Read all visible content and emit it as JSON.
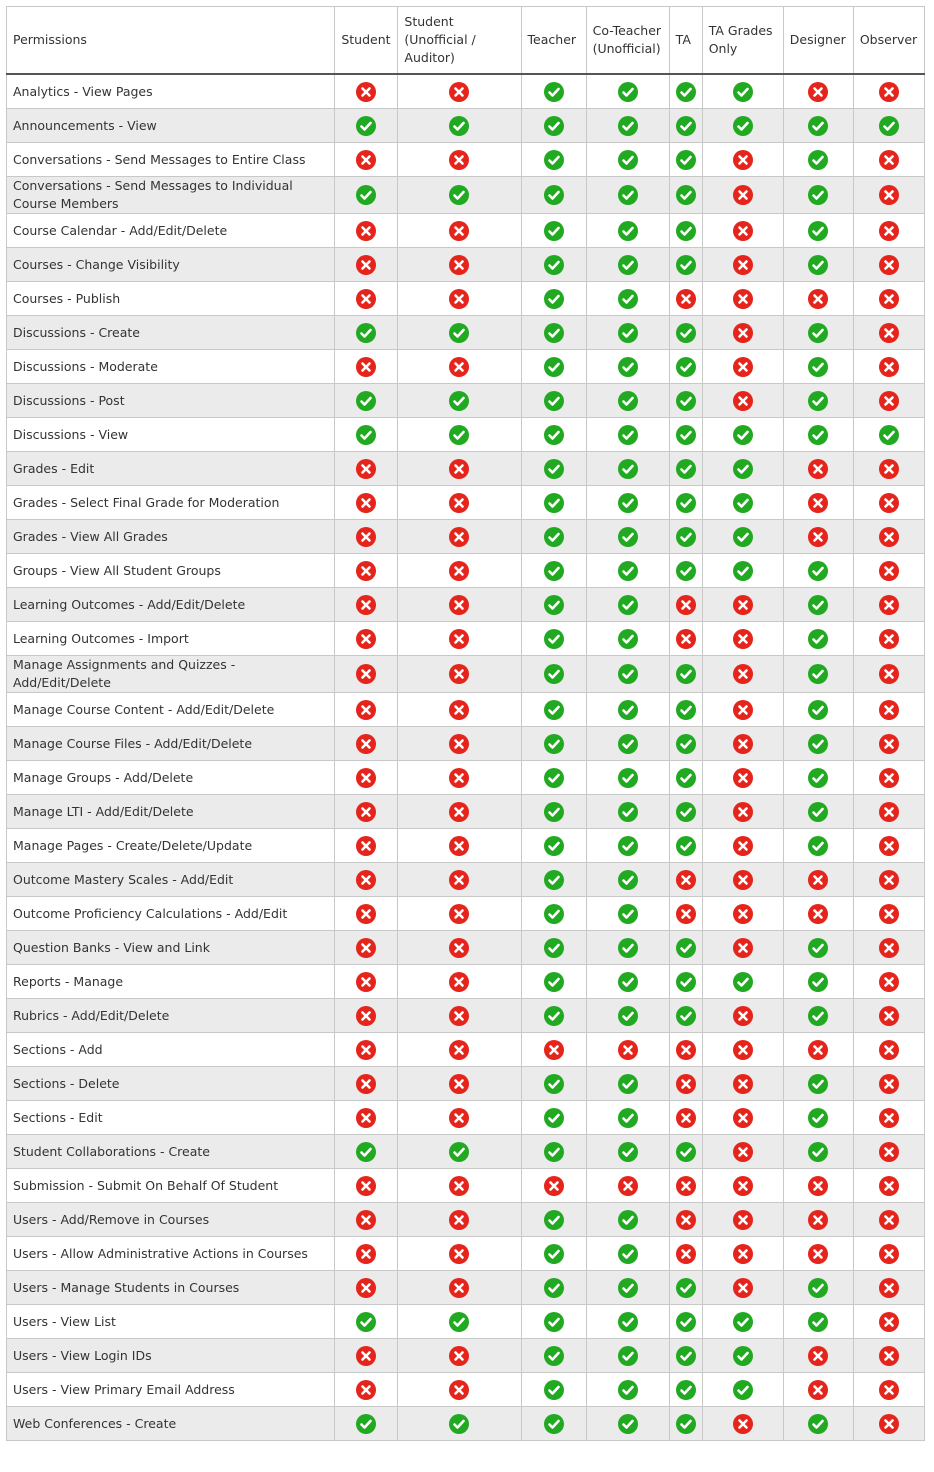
{
  "colors": {
    "allowed": "#22a922",
    "denied": "#e5241b"
  },
  "icons": {
    "Y": "check-circle-icon",
    "N": "x-circle-icon"
  },
  "headers": [
    "Permissions",
    "Student",
    "Student (Unofficial / Auditor)",
    "Teacher",
    "Co-Teacher (Unofficial)",
    "TA",
    "TA Grades Only",
    "Designer",
    "Observer"
  ],
  "rows": [
    {
      "label": "Analytics - View Pages",
      "values": "NNYYYYNN"
    },
    {
      "label": "Announcements - View",
      "values": "YYYYYYYY"
    },
    {
      "label": "Conversations - Send Messages to Entire Class",
      "values": "NNYYYNYN"
    },
    {
      "label": "Conversations - Send Messages to Individual Course Members",
      "values": "YYYYYNYN"
    },
    {
      "label": "Course Calendar - Add/Edit/Delete",
      "values": "NNYYYNYN"
    },
    {
      "label": "Courses - Change Visibility",
      "values": "NNYYYNYN"
    },
    {
      "label": "Courses - Publish",
      "values": "NNYYNNNN"
    },
    {
      "label": "Discussions - Create",
      "values": "YYYYYNYN"
    },
    {
      "label": "Discussions - Moderate",
      "values": "NNYYYNYN"
    },
    {
      "label": "Discussions - Post",
      "values": "YYYYYNYN"
    },
    {
      "label": "Discussions - View",
      "values": "YYYYYYYY"
    },
    {
      "label": "Grades - Edit",
      "values": "NNYYYYNN"
    },
    {
      "label": "Grades - Select Final Grade for Moderation",
      "values": "NNYYYYNN"
    },
    {
      "label": "Grades - View All Grades",
      "values": "NNYYYYNN"
    },
    {
      "label": "Groups - View All Student Groups",
      "values": "NNYYYYYN"
    },
    {
      "label": "Learning Outcomes - Add/Edit/Delete",
      "values": "NNYYNNYN"
    },
    {
      "label": "Learning Outcomes - Import",
      "values": "NNYYNNYN"
    },
    {
      "label": "Manage Assignments and Quizzes - Add/Edit/Delete",
      "values": "NNYYYNYN"
    },
    {
      "label": "Manage Course Content - Add/Edit/Delete",
      "values": "NNYYYNYN"
    },
    {
      "label": "Manage Course Files - Add/Edit/Delete",
      "values": "NNYYYNYN"
    },
    {
      "label": "Manage Groups - Add/Delete",
      "values": "NNYYYNYN"
    },
    {
      "label": "Manage LTI - Add/Edit/Delete",
      "values": "NNYYYNYN"
    },
    {
      "label": "Manage Pages - Create/Delete/Update",
      "values": "NNYYYNYN"
    },
    {
      "label": "Outcome Mastery Scales - Add/Edit",
      "values": "NNYYNNNN"
    },
    {
      "label": "Outcome Proficiency Calculations - Add/Edit",
      "values": "NNYYNNNN"
    },
    {
      "label": "Question Banks - View and Link",
      "values": "NNYYYNYN"
    },
    {
      "label": "Reports - Manage",
      "values": "NNYYYYYN"
    },
    {
      "label": "Rubrics - Add/Edit/Delete",
      "values": "NNYYYNYN"
    },
    {
      "label": "Sections - Add",
      "values": "NNNNNNNN"
    },
    {
      "label": "Sections - Delete",
      "values": "NNYYNNYN"
    },
    {
      "label": "Sections - Edit",
      "values": "NNYYNNYN"
    },
    {
      "label": "Student Collaborations - Create",
      "values": "YYYYYNYN"
    },
    {
      "label": "Submission - Submit On Behalf Of Student",
      "values": "NNNNNNNN"
    },
    {
      "label": "Users - Add/Remove in Courses",
      "values": "NNYYNNNN"
    },
    {
      "label": "Users - Allow Administrative Actions in Courses",
      "values": "NNYYNNNN"
    },
    {
      "label": "Users - Manage Students in Courses",
      "values": "NNYYYNYN"
    },
    {
      "label": "Users - View List",
      "values": "YYYYYYYN"
    },
    {
      "label": "Users - View Login IDs",
      "values": "NNYYYYNN"
    },
    {
      "label": "Users - View Primary Email Address",
      "values": "NNYYYYNN"
    },
    {
      "label": "Web Conferences - Create",
      "values": "YYYYYNYN"
    }
  ]
}
